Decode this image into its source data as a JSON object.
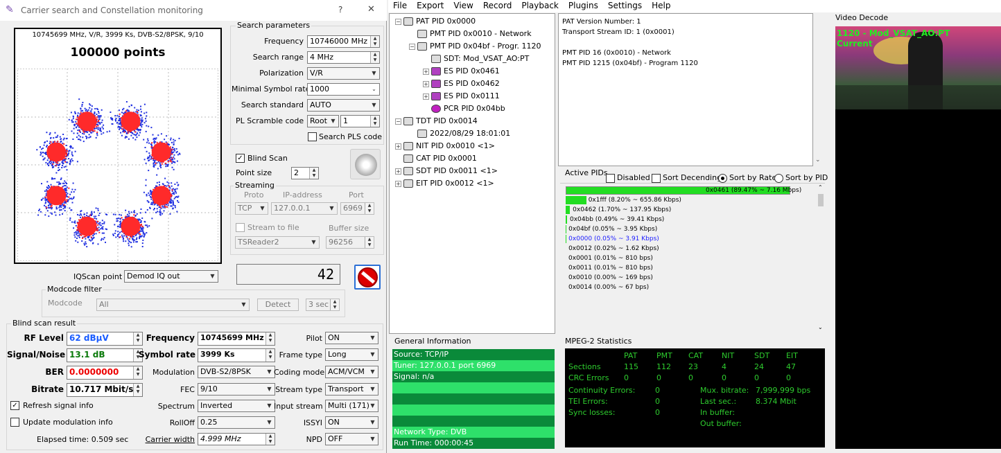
{
  "window": {
    "title": "Carrier search and Constellation monitoring",
    "help": "?",
    "close": "✕"
  },
  "constellation": {
    "header": "10745699 MHz, V/R, 3999 Ks, DVB-S2/8PSK, 9/10",
    "points": "100000 points"
  },
  "search": {
    "title": "Search parameters",
    "frequency_label": "Frequency",
    "frequency": "10746000 MHz",
    "range_label": "Search range",
    "range": "4 MHz",
    "polarization_label": "Polarization",
    "polarization": "V/R",
    "minsr_label": "Minimal Symbol rate",
    "minsr": "1000",
    "standard_label": "Search standard",
    "standard": "AUTO",
    "pls_label": "PL Scramble code",
    "pls_mode": "Root",
    "pls_value": "1",
    "search_pls_label": "Search PLS code"
  },
  "blind": {
    "label": "Blind Scan",
    "point_size_label": "Point size",
    "point_size": "2"
  },
  "streaming": {
    "title": "Streaming",
    "proto_label": "Proto",
    "ip_label": "IP-address",
    "port_label": "Port",
    "proto": "TCP",
    "ip": "127.0.0.1",
    "port": "6969",
    "stream_file_label": "Stream to file",
    "buffer_label": "Buffer size",
    "reader": "TSReader2",
    "buffer": "96256"
  },
  "iq": {
    "label": "IQScan point",
    "value": "Demod IQ out",
    "counter": "42"
  },
  "modcode": {
    "title": "Modcode filter",
    "label": "Modcode",
    "value": "All",
    "detect": "Detect",
    "sec": "3 sec"
  },
  "result": {
    "title": "Blind scan result",
    "rf_label": "RF Level",
    "rf": "62 dBµV",
    "sn_label": "Signal/Noise",
    "sn": "13.1 dB",
    "ber_label": "BER",
    "ber": "0.0000000",
    "bitrate_label": "Bitrate",
    "bitrate": "10.717 Mbit/s",
    "freq_label": "Frequency",
    "freq": "10745699 MHz",
    "sr_label": "Symbol rate",
    "sr": "3999 Ks",
    "mod_label": "Modulation",
    "mod": "DVB-S2/8PSK",
    "fec_label": "FEC",
    "fec": "9/10",
    "spectrum_label": "Spectrum",
    "spectrum": "Inverted",
    "rolloff_label": "RollOff",
    "rolloff": "0.25",
    "cw_label": "Carrier width",
    "cw": "4.999 MHz",
    "pilot_label": "Pilot",
    "pilot": "ON",
    "frame_label": "Frame type",
    "frame": "Long",
    "coding_label": "Coding mode",
    "coding": "ACM/VCM",
    "stype_label": "Stream type",
    "stype": "Transport",
    "input_label": "Input stream",
    "input": "Multi (171)",
    "issyi_label": "ISSYI",
    "issyi": "ON",
    "npd_label": "NPD",
    "npd": "OFF",
    "refresh_label": "Refresh signal info",
    "update_label": "Update modulation info",
    "elapsed": "Elapsed time: 0.509 sec"
  },
  "menu": [
    "File",
    "Export",
    "View",
    "Record",
    "Playback",
    "Plugins",
    "Settings",
    "Help"
  ],
  "tree": [
    {
      "label": "PAT PID 0x0000",
      "icon": "PAT"
    },
    {
      "label": "PMT PID 0x0010 - Network",
      "icon": "PMT"
    },
    {
      "label": "PMT PID 0x04bf - Progr. 1120",
      "icon": "PMT"
    },
    {
      "label": "SDT: Mod_VSAT_AO:PT",
      "icon": "SDT"
    },
    {
      "label": "ES PID 0x0461",
      "icon": "ES"
    },
    {
      "label": "ES PID 0x0462",
      "icon": "ES"
    },
    {
      "label": "ES PID 0x0111",
      "icon": "ES"
    },
    {
      "label": "PCR PID 0x04bb",
      "icon": "PCR"
    },
    {
      "label": "TDT PID 0x0014",
      "icon": "TDT"
    },
    {
      "label": "2022/08/29 18:01:01",
      "icon": "TDT"
    },
    {
      "label": "NIT PID 0x0010 <1>",
      "icon": "NIT"
    },
    {
      "label": "CAT PID 0x0001",
      "icon": "CAT"
    },
    {
      "label": "SDT PID 0x0011 <1>",
      "icon": "SDT"
    },
    {
      "label": "EIT PID 0x0012 <1>",
      "icon": "EIT"
    }
  ],
  "info_lines": [
    "PAT Version Number: 1",
    "Transport Stream ID: 1 (0x0001)",
    "",
    "PMT PID 16 (0x0010) - Network",
    "PMT PID 1215 (0x04bf) - Program 1120"
  ],
  "active": {
    "title": "Active PIDs",
    "disabled": "Disabled",
    "sort_desc": "Sort Decending",
    "sort_rate": "Sort by Rate",
    "sort_pid": "Sort by PID"
  },
  "pids": [
    {
      "text": "0x0461 (89.47% ~ 7.16 Mbps)",
      "pct": 89.47
    },
    {
      "text": "0x1fff (8.20% ~ 655.86 Kbps)",
      "pct": 8.2
    },
    {
      "text": "0x0462 (1.70% ~ 137.95 Kbps)",
      "pct": 1.7
    },
    {
      "text": "0x04bb (0.49% ~ 39.41 Kbps)",
      "pct": 0.49
    },
    {
      "text": "0x04bf (0.05% ~ 3.95 Kbps)",
      "pct": 0.05
    },
    {
      "text": "0x0000 (0.05% ~ 3.91 Kbps)",
      "pct": 0.05,
      "color": "#1a1aff"
    },
    {
      "text": "0x0012 (0.02% ~ 1.62 Kbps)",
      "pct": 0.02
    },
    {
      "text": "0x0001 (0.01% ~ 810 bps)",
      "pct": 0.01
    },
    {
      "text": "0x0011 (0.01% ~ 810 bps)",
      "pct": 0.01
    },
    {
      "text": "0x0010 (0.00% ~ 169 bps)",
      "pct": 0
    },
    {
      "text": "0x0014 (0.00% ~ 67 bps)",
      "pct": 0
    }
  ],
  "general": {
    "title": "General Information",
    "source": "Source: TCP/IP",
    "tuner": "Tuner: 127.0.0.1 port 6969",
    "signal": "Signal: n/a",
    "network": "Network Type: DVB",
    "runtime": "Run Time: 000:00:45"
  },
  "mpeg": {
    "title": "MPEG-2 Statistics",
    "headers": [
      "PAT",
      "PMT",
      "CAT",
      "NIT",
      "SDT",
      "EIT"
    ],
    "sections_label": "Sections",
    "sections": [
      "115",
      "112",
      "23",
      "4",
      "24",
      "47"
    ],
    "crc_label": "CRC Errors",
    "crc": [
      "0",
      "0",
      "0",
      "0",
      "0",
      "0"
    ],
    "cont_label": "Continuity Errors:",
    "cont": "0",
    "tei_label": "TEI Errors:",
    "tei": "0",
    "sync_label": "Sync losses:",
    "sync": "0",
    "mux_label": "Mux. bitrate:",
    "mux": "7,999,999 bps",
    "last_label": "Last sec.:",
    "last": "8.374 Mbit",
    "inbuf_label": "In buffer:",
    "outbuf_label": "Out buffer:"
  },
  "video": {
    "title": "Video Decode",
    "overlay1": "1120 - Mod_VSAT_AO:PT",
    "overlay2": "Current"
  }
}
